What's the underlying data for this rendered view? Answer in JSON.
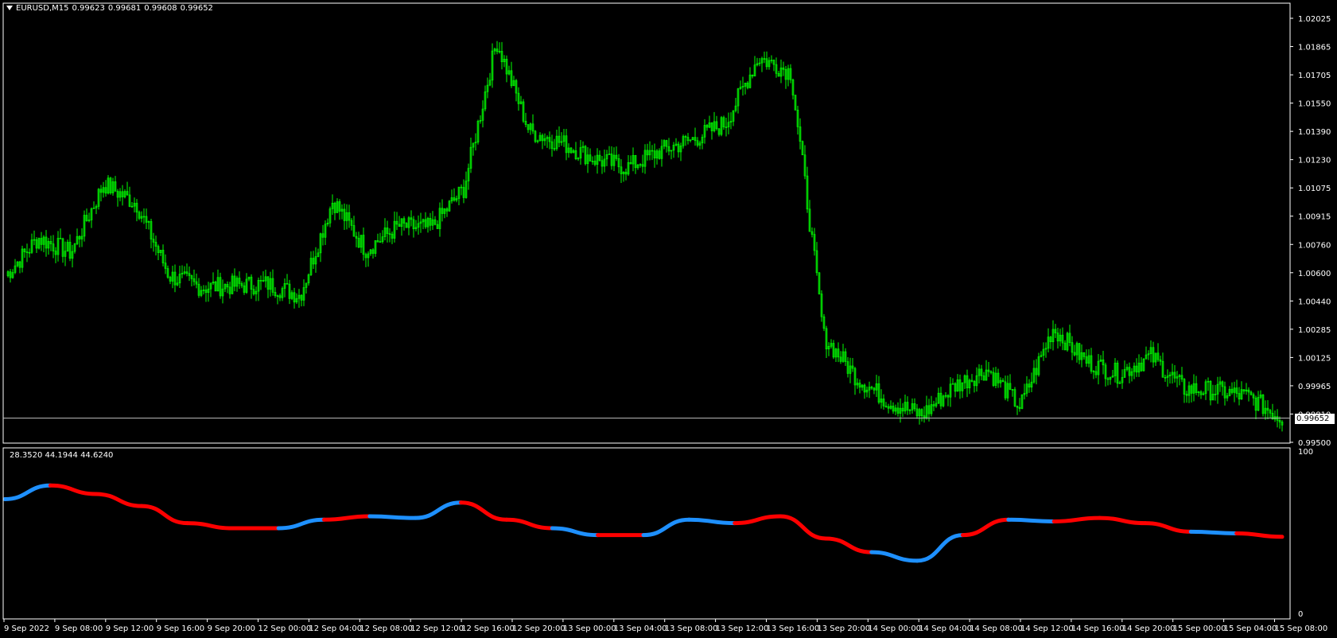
{
  "window": {
    "symbol": "EURUSD,M15",
    "ohlc": [
      "0.99623",
      "0.99681",
      "0.99608",
      "0.99652"
    ]
  },
  "indicator": {
    "values_label": "28.3520 44.1944 44.6240",
    "scale_top": "100",
    "scale_bottom": "0"
  },
  "colors": {
    "background": "#000000",
    "candle": "#00ff00",
    "axes": "#ffffff",
    "line_up": "#1e90ff",
    "line_down": "#ff0000"
  },
  "chart_data": [
    {
      "type": "candlestick",
      "title": "EURUSD,M15",
      "current_price": 0.99652,
      "current_price_label": "0.99652",
      "ylim": [
        0.995,
        1.0218
      ],
      "price_axis_labels": [
        "1.02025",
        "1.01865",
        "1.01705",
        "1.01550",
        "1.01390",
        "1.01230",
        "1.01075",
        "1.00915",
        "1.00760",
        "1.00600",
        "1.00440",
        "1.00285",
        "1.00125",
        "0.99965",
        "0.99810",
        "0.99500"
      ],
      "time_axis_labels": [
        "9 Sep 2022",
        "9 Sep 08:00",
        "9 Sep 12:00",
        "9 Sep 16:00",
        "9 Sep 20:00",
        "12 Sep 00:00",
        "12 Sep 04:00",
        "12 Sep 08:00",
        "12 Sep 12:00",
        "12 Sep 16:00",
        "12 Sep 20:00",
        "13 Sep 00:00",
        "13 Sep 04:00",
        "13 Sep 08:00",
        "13 Sep 12:00",
        "13 Sep 16:00",
        "13 Sep 20:00",
        "14 Sep 00:00",
        "14 Sep 04:00",
        "14 Sep 08:00",
        "14 Sep 12:00",
        "14 Sep 16:00",
        "14 Sep 20:00",
        "15 Sep 00:00",
        "15 Sep 04:00",
        "15 Sep 08:00"
      ],
      "anchor_closes": [
        1.0052,
        1.0075,
        1.0066,
        1.0108,
        1.0096,
        1.0052,
        1.0045,
        1.0046,
        1.0047,
        1.004,
        1.0098,
        1.0068,
        1.0082,
        1.0081,
        1.0105,
        1.0195,
        1.014,
        1.0133,
        1.0123,
        1.0118,
        1.0128,
        1.0135,
        1.0145,
        1.0185,
        1.0176,
        1.0015,
        0.999,
        0.9975,
        0.9967,
        0.9985,
        0.9995,
        0.9972,
        1.002,
        1.0,
        0.9992,
        1.0003,
        0.9983,
        0.9982,
        0.9978,
        0.9965
      ]
    },
    {
      "type": "line",
      "ylim": [
        0,
        100
      ],
      "anchor_values": [
        70,
        78,
        73,
        66,
        56,
        53,
        53,
        58,
        60,
        59,
        68,
        58,
        53,
        49,
        49,
        58,
        56,
        60,
        47,
        39,
        34,
        49,
        58,
        57,
        59,
        56,
        51,
        50,
        48
      ],
      "segment_colors": [
        "up",
        "down",
        "down",
        "down",
        "down",
        "down",
        "up",
        "down",
        "up",
        "up",
        "down",
        "down",
        "up",
        "down",
        "up",
        "up",
        "down",
        "down",
        "down",
        "up",
        "up",
        "down",
        "up",
        "down",
        "down",
        "down",
        "up",
        "down",
        "down"
      ]
    }
  ]
}
